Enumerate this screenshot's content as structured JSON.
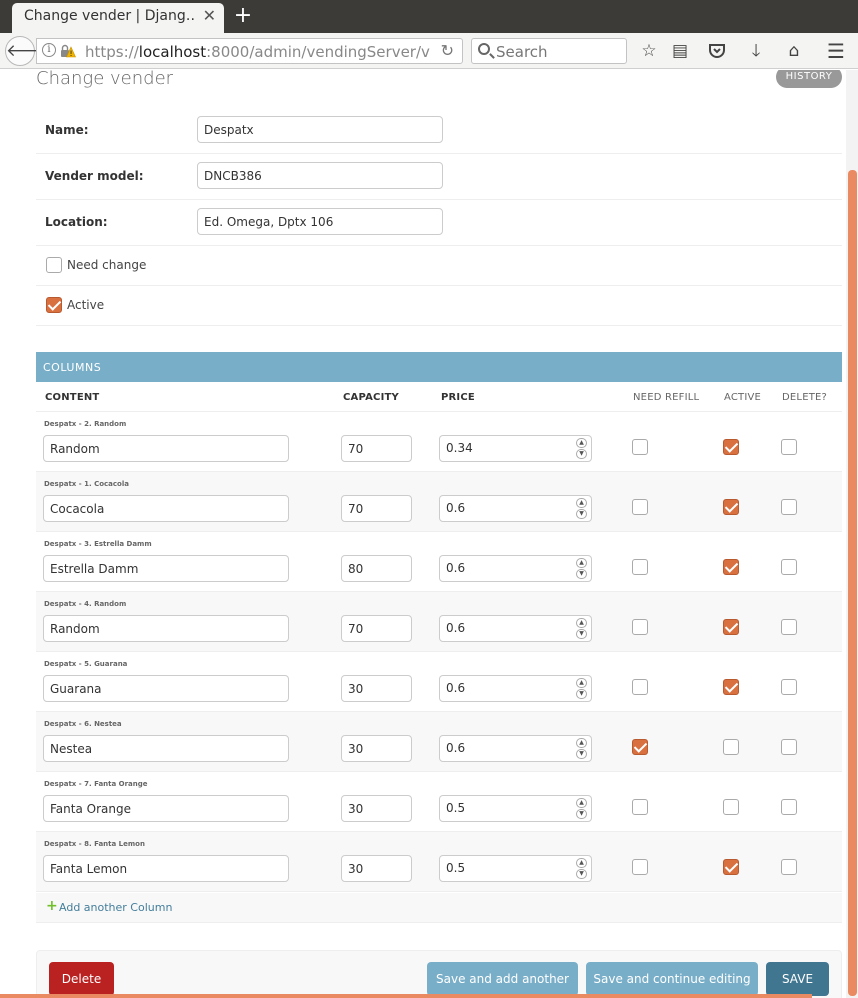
{
  "browser": {
    "tab_title": "Change vender | Djang…",
    "url_prefix": "https://",
    "url_host": "localhost",
    "url_rest": ":8000/admin/vendingServer/v",
    "search_placeholder": "Search"
  },
  "page": {
    "title": "Change vender",
    "history_label": "HISTORY"
  },
  "form": {
    "name_label": "Name:",
    "name_value": "Despatx",
    "model_label": "Vender model:",
    "model_value": "DNCB386",
    "location_label": "Location:",
    "location_value": "Ed. Omega, Dptx 106",
    "need_change_label": "Need change",
    "need_change_checked": false,
    "active_label": "Active",
    "active_checked": true
  },
  "inline": {
    "heading": "COLUMNS",
    "headers": {
      "content": "CONTENT",
      "capacity": "CAPACITY",
      "price": "PRICE",
      "need_refill": "NEED REFILL",
      "active": "ACTIVE",
      "delete": "DELETE?"
    },
    "rows": [
      {
        "caption": "Despatx - 2. Random",
        "content": "Random",
        "capacity": "70",
        "price": "0.34",
        "need_refill": false,
        "active": true,
        "delete": false
      },
      {
        "caption": "Despatx - 1. Cocacola",
        "content": "Cocacola",
        "capacity": "70",
        "price": "0.6",
        "need_refill": false,
        "active": true,
        "delete": false
      },
      {
        "caption": "Despatx - 3. Estrella Damm",
        "content": "Estrella Damm",
        "capacity": "80",
        "price": "0.6",
        "need_refill": false,
        "active": true,
        "delete": false
      },
      {
        "caption": "Despatx - 4. Random",
        "content": "Random",
        "capacity": "70",
        "price": "0.6",
        "need_refill": false,
        "active": true,
        "delete": false
      },
      {
        "caption": "Despatx - 5. Guarana",
        "content": "Guarana",
        "capacity": "30",
        "price": "0.6",
        "need_refill": false,
        "active": true,
        "delete": false
      },
      {
        "caption": "Despatx - 6. Nestea",
        "content": "Nestea",
        "capacity": "30",
        "price": "0.6",
        "need_refill": true,
        "active": false,
        "delete": false
      },
      {
        "caption": "Despatx - 7. Fanta Orange",
        "content": "Fanta Orange",
        "capacity": "30",
        "price": "0.5",
        "need_refill": false,
        "active": false,
        "delete": false
      },
      {
        "caption": "Despatx - 8. Fanta Lemon",
        "content": "Fanta Lemon",
        "capacity": "30",
        "price": "0.5",
        "need_refill": false,
        "active": true,
        "delete": false
      }
    ],
    "add_label": "Add another Column"
  },
  "submit": {
    "delete_label": "Delete",
    "save_add_label": "Save and add another",
    "save_continue_label": "Save and continue editing",
    "save_label": "SAVE"
  },
  "colors": {
    "accent": "#d9703f",
    "header_blue": "#79aec8",
    "save_blue": "#417690",
    "delete_red": "#ba2121"
  }
}
